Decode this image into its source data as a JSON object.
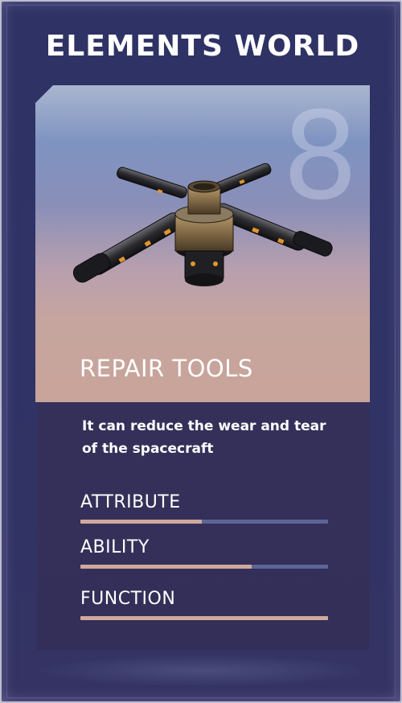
{
  "header": {
    "title": "ELEMENTS WORLD"
  },
  "item": {
    "rarity_number": "8",
    "name": "REPAIR TOOLS",
    "description": "It can reduce the wear and tear of the spacecraft",
    "icon": "repair-tool-drone-icon"
  },
  "stats": [
    {
      "label": "ATTRIBUTE",
      "fill": 0.49
    },
    {
      "label": "ABILITY",
      "fill": 0.69
    },
    {
      "label": "FUNCTION",
      "fill": 1.0
    }
  ],
  "colors": {
    "card_bg": "#2e3264",
    "info_bg": "#34305a",
    "bar_track": "#5e6496",
    "bar_fill": "#d1a89c",
    "text": "#ffffff"
  }
}
